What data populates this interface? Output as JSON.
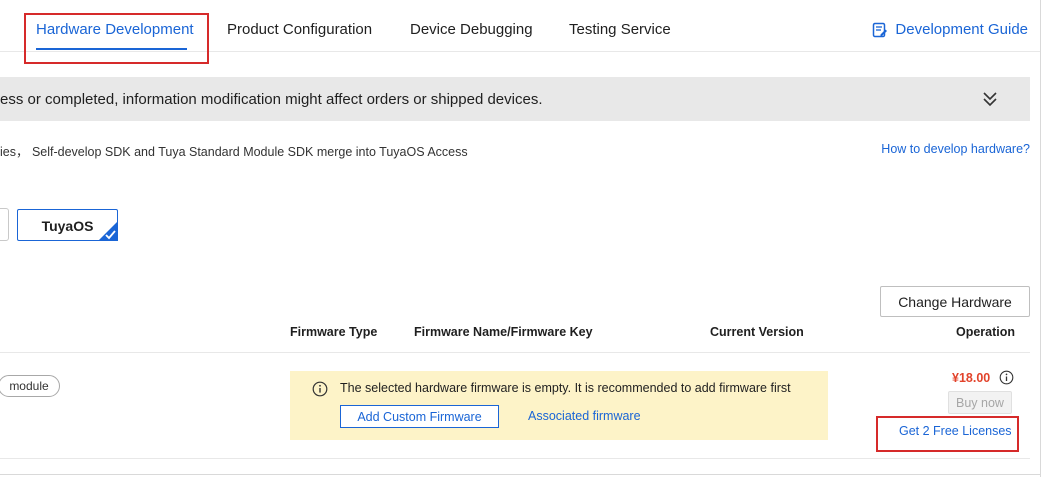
{
  "tabs": [
    {
      "label": "Hardware Development",
      "active": true
    },
    {
      "label": "Product Configuration",
      "active": false
    },
    {
      "label": "Device Debugging",
      "active": false
    },
    {
      "label": "Testing Service",
      "active": false
    }
  ],
  "header": {
    "guide_label": "Development Guide",
    "guide_icon": "guide-doc-icon"
  },
  "notice": {
    "text": "ess or completed, information modification might affect orders or shipped devices.",
    "toggle_icon": "double-chevron-down-icon"
  },
  "info": {
    "text": "ies， Self-develop SDK and Tuya Standard Module SDK merge into TuyaOS Access",
    "help_link": "How to develop hardware?"
  },
  "os_options": {
    "selected_label": "TuyaOS",
    "check_icon": "checkmark-icon"
  },
  "toolbar": {
    "change_hardware_label": "Change Hardware"
  },
  "table": {
    "headers": {
      "firmware_type": "Firmware Type",
      "firmware_name": "Firmware Name/Firmware Key",
      "current_version": "Current Version",
      "operation": "Operation"
    },
    "row": {
      "tag": "module",
      "firmware_message": "The selected hardware firmware is empty. It is recommended to add firmware first",
      "add_custom_label": "Add Custom Firmware",
      "associated_label": "Associated firmware",
      "price": "¥18.00",
      "buy_label": "Buy now",
      "licenses_label": "Get 2 Free Licenses"
    }
  },
  "colors": {
    "accent": "#1a65d6",
    "highlight_box": "#d62a2a",
    "price": "#e2432b",
    "notice_bg": "#e8e8e8",
    "firmware_panel_bg": "#fdf3c8"
  }
}
